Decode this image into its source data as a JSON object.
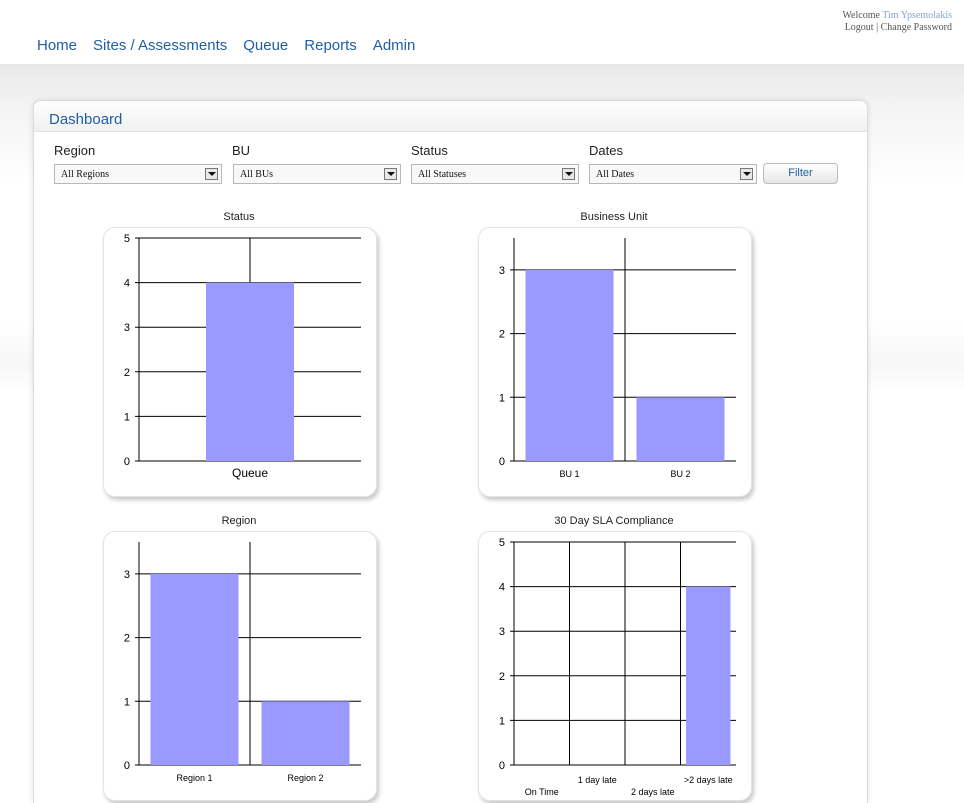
{
  "nav": {
    "items": [
      "Home",
      "Sites / Assessments",
      "Queue",
      "Reports",
      "Admin"
    ]
  },
  "user": {
    "welcome": "Welcome",
    "name": "Tim Ypsemolakis",
    "logout": "Logout",
    "separator": "|",
    "change_password": "Change Password"
  },
  "dashboard": {
    "title": "Dashboard",
    "filters": {
      "region": {
        "label": "Region",
        "value": "All Regions"
      },
      "bu": {
        "label": "BU",
        "value": "All BUs"
      },
      "status": {
        "label": "Status",
        "value": "All Statuses"
      },
      "dates": {
        "label": "Dates",
        "value": "All Dates"
      },
      "filter_button": "Filter"
    }
  },
  "colors": {
    "bar": "#9999ff",
    "link": "#1f5fa8"
  },
  "chart_data": [
    {
      "id": "status",
      "type": "bar",
      "title": "Status",
      "categories": [
        "Queue"
      ],
      "values": [
        4
      ],
      "ylim": [
        0,
        5
      ],
      "yticks": [
        0,
        1,
        2,
        3,
        4,
        5
      ],
      "xlabel": "",
      "ylabel": "",
      "grid": true
    },
    {
      "id": "bu",
      "type": "bar",
      "title": "Business Unit",
      "categories": [
        "BU 1",
        "BU 2"
      ],
      "values": [
        3,
        1
      ],
      "ylim": [
        0,
        3.5
      ],
      "yticks": [
        0,
        1,
        2,
        3
      ],
      "xlabel": "",
      "ylabel": "",
      "grid": true
    },
    {
      "id": "region",
      "type": "bar",
      "title": "Region",
      "categories": [
        "Region 1",
        "Region 2"
      ],
      "values": [
        3,
        1
      ],
      "ylim": [
        0,
        3.5
      ],
      "yticks": [
        0,
        1,
        2,
        3
      ],
      "xlabel": "",
      "ylabel": "",
      "grid": true
    },
    {
      "id": "sla",
      "type": "bar",
      "title": "30 Day SLA Compliance",
      "categories": [
        "On Time",
        "1 day late",
        "2 days late",
        ">2 days late"
      ],
      "values": [
        0,
        0,
        0,
        4
      ],
      "ylim": [
        0,
        5
      ],
      "yticks": [
        0,
        1,
        2,
        3,
        4,
        5
      ],
      "xlabel": "",
      "ylabel": "",
      "grid": true
    }
  ]
}
